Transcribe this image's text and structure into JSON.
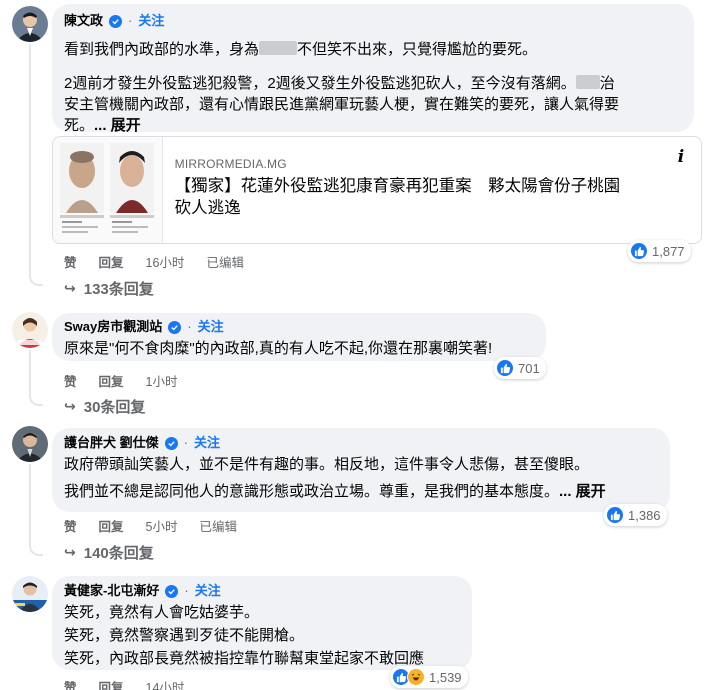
{
  "comments": [
    {
      "author": "陳文政",
      "follow": "关注",
      "paragraphs": [
        [
          "看到我們內政部的水準，身為",
          "不但笑不出來，只覺得尷尬的要死。"
        ],
        [
          "2週前才發生外役監逃犯殺警，2週後又發生外役監逃犯砍人，至今沒有落網。",
          "治"
        ],
        [
          "安主管機關內政部，還有心情跟民進黨網軍玩藝人梗，實在難笑的要死，讓人氣得要"
        ],
        [
          "死。"
        ]
      ],
      "more": "... 展开",
      "link": {
        "domain": "MIRRORMEDIA.MG",
        "title_line1": "【獨家】花蓮外役監逃犯康育豪再犯重案　夥太陽會份子桃園",
        "title_line2": "砍人逃逸",
        "info": "i"
      },
      "actions": {
        "like": "赞",
        "reply": "回复",
        "time": "16小时",
        "edited": "已编辑"
      },
      "reactions": "1,877",
      "replies": "133条回复"
    },
    {
      "author": "Sway房市觀測站",
      "follow": "关注",
      "text": "原來是\"何不食肉糜\"的內政部,真的有人吃不起,你還在那裏嘲笑著!",
      "actions": {
        "like": "赞",
        "reply": "回复",
        "time": "1小时"
      },
      "reactions": "701",
      "replies": "30条回复"
    },
    {
      "author": "護台胖犬 劉仕傑",
      "follow": "关注",
      "line1": "政府帶頭訕笑藝人，並不是件有趣的事。相反地，這件事令人悲傷，甚至傻眼。",
      "line2": "我們並不總是認同他人的意識形態或政治立場。尊重，是我們的基本態度。",
      "more": "... 展开",
      "actions": {
        "like": "赞",
        "reply": "回复",
        "time": "5小时",
        "edited": "已编辑"
      },
      "reactions": "1,386",
      "replies": "140条回复"
    },
    {
      "author": "黃健家-北屯漸好",
      "follow": "关注",
      "line1": "笑死，竟然有人會吃姑婆芋。",
      "line2": "笑死，竟然警察遇到歹徒不能開槍。",
      "line3": "笑死，內政部長竟然被指控靠竹聯幫東堂起家不敢回應",
      "actions": {
        "like": "赞",
        "reply": "回复",
        "time": "14小时"
      },
      "reactions": "1,539"
    }
  ],
  "colors": {
    "accent": "#1877f2",
    "bubble": "#f0f2f5",
    "muted": "#65676b"
  },
  "icons": [
    "verified-badge-icon",
    "like-reaction-icon",
    "haha-reaction-icon",
    "reply-arrow-icon",
    "info-icon"
  ]
}
